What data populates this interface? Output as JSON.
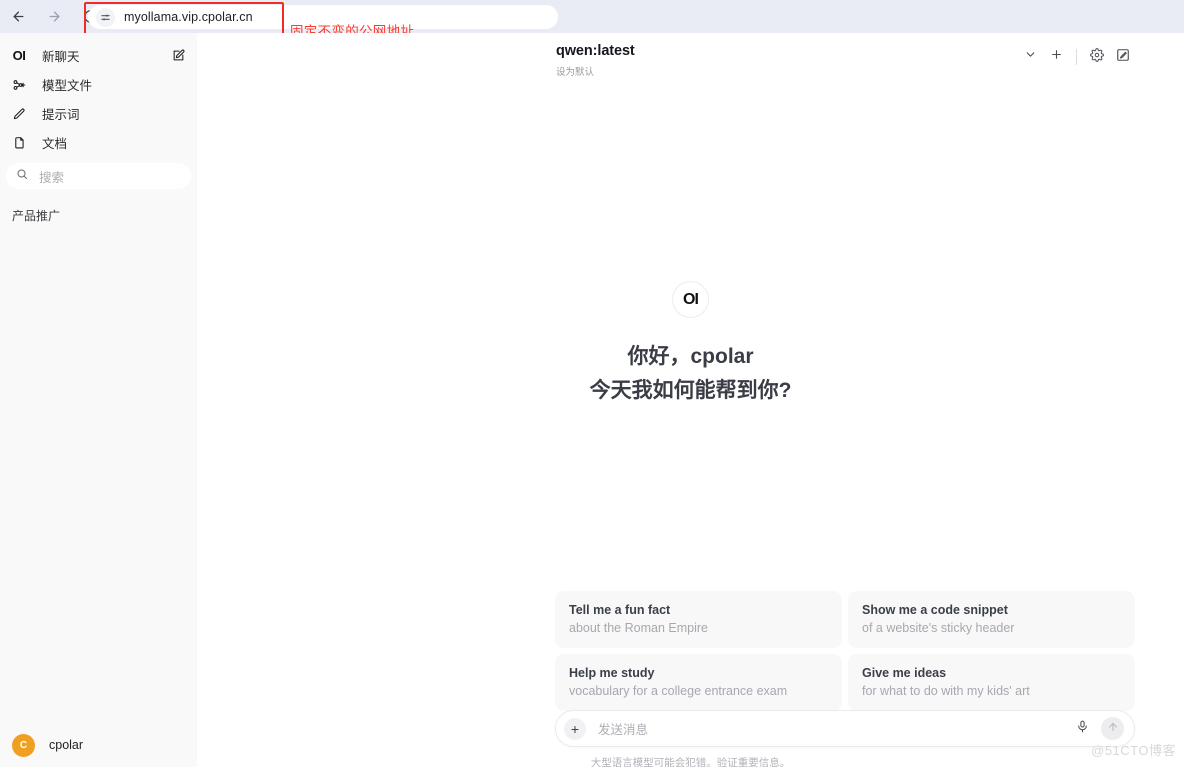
{
  "browser": {
    "back_icon": "back-arrow-icon",
    "forward_icon": "forward-arrow-icon",
    "reload_icon": "reload-icon",
    "site_settings_icon": "tune-sliders-icon",
    "url": "myollama.vip.cpolar.cn"
  },
  "annotation": {
    "text": "固定不变的公网地址",
    "color": "#fb3b30",
    "box_color": "#ef2d23"
  },
  "sidebar": {
    "items": [
      {
        "label": "新聊天",
        "icon": "open-webui-logo-icon",
        "trailing_icon": "new-chat-edit-icon"
      },
      {
        "label": "模型文件",
        "icon": "modelfiles-node-icon",
        "trailing_icon": ""
      },
      {
        "label": "提示词",
        "icon": "pencil-icon",
        "trailing_icon": ""
      },
      {
        "label": "文档",
        "icon": "documents-icon",
        "trailing_icon": ""
      }
    ],
    "logo_text": "OI",
    "search": {
      "placeholder": "搜索",
      "icon": "search-icon"
    },
    "section_label": "产品推广",
    "user": {
      "name": "cpolar",
      "avatar_letter": "C",
      "avatar_color": "#f0a020"
    }
  },
  "chat_header": {
    "model_name": "qwen:latest",
    "set_default_label": "设为默认",
    "actions": [
      {
        "name": "chevron-down-icon"
      },
      {
        "name": "plus-icon"
      },
      {
        "name": "settings-gear-icon"
      },
      {
        "name": "edit-square-icon"
      }
    ]
  },
  "greeting": {
    "logo_text": "OI",
    "line1": "你好，cpolar",
    "line2": "今天我如何能帮到你?"
  },
  "suggestions": [
    {
      "title": "Tell me a fun fact",
      "subtitle": "about the Roman Empire"
    },
    {
      "title": "Show me a code snippet",
      "subtitle": "of a website's sticky header"
    },
    {
      "title": "Help me study",
      "subtitle": "vocabulary for a college entrance exam"
    },
    {
      "title": "Give me ideas",
      "subtitle": "for what to do with my kids' art"
    }
  ],
  "composer": {
    "placeholder": "发送消息",
    "plus_label": "+",
    "mic_icon": "microphone-icon",
    "send_icon": "send-arrow-up-icon",
    "disclaimer": "大型语言模型可能会犯错。验证重要信息。"
  },
  "watermark": "@51CTO博客"
}
